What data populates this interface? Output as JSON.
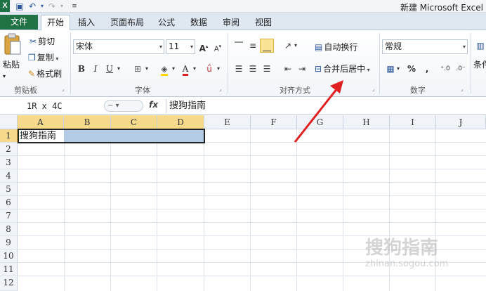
{
  "window": {
    "title": "新建 Microsoft Excel",
    "app_logo": "X"
  },
  "tabs": {
    "file": "文件",
    "items": [
      "开始",
      "插入",
      "页面布局",
      "公式",
      "数据",
      "审阅",
      "视图"
    ]
  },
  "ribbon": {
    "clipboard": {
      "label": "剪贴板",
      "paste": "粘贴",
      "cut": "剪切",
      "copy": "复制",
      "format_painter": "格式刷"
    },
    "font": {
      "label": "字体",
      "font_name": "宋体",
      "font_size": "11",
      "bold": "B",
      "italic": "I",
      "underline": "U",
      "grow": "A",
      "shrink": "A"
    },
    "alignment": {
      "label": "对齐方式",
      "wrap_text": "自动换行",
      "merge_center": "合并后居中"
    },
    "number": {
      "label": "数字",
      "format": "常规",
      "percent": "%",
      "comma": ","
    },
    "styles_partial": "条件"
  },
  "formula_bar": {
    "name_box": "1R x 4C",
    "fx": "fx",
    "content": "搜狗指南"
  },
  "grid": {
    "columns": [
      "A",
      "B",
      "C",
      "D",
      "E",
      "F",
      "G",
      "H",
      "I",
      "J"
    ],
    "rows": [
      "1",
      "2",
      "3",
      "4",
      "5",
      "6",
      "7",
      "8",
      "9",
      "10",
      "11",
      "12"
    ],
    "cell_a1": "搜狗指南"
  },
  "watermark": {
    "main": "搜狗指南",
    "sub": "zhinan.sogou.com"
  },
  "colors": {
    "file_tab": "#217346",
    "selection": "#b4cbe6",
    "arrow": "#e02020"
  }
}
